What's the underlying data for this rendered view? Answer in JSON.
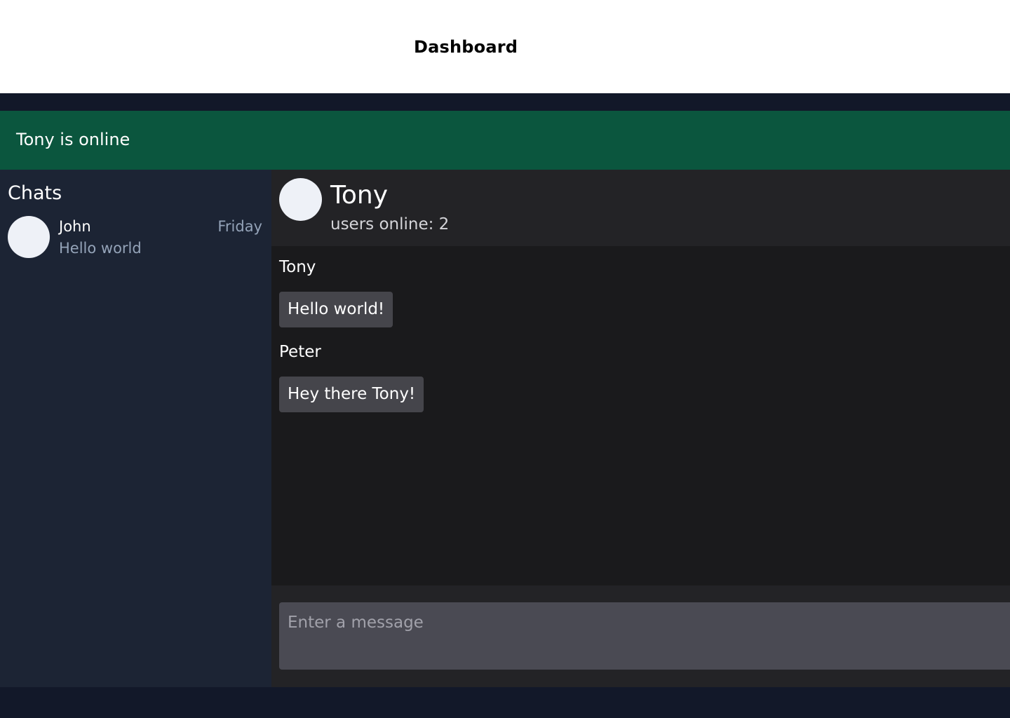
{
  "header": {
    "title": "Dashboard"
  },
  "status": {
    "online_text": "Tony is online"
  },
  "sidebar": {
    "title": "Chats",
    "chats": [
      {
        "name": "John",
        "preview": "Hello world",
        "time": "Friday"
      }
    ]
  },
  "conversation": {
    "name": "Tony",
    "subtitle": "users online: 2",
    "messages": [
      {
        "sender": "Tony",
        "text": "Hello world!"
      },
      {
        "sender": "Peter",
        "text": "Hey there Tony!"
      }
    ]
  },
  "composer": {
    "placeholder": "Enter a message"
  },
  "colors": {
    "online_banner": "#0b563e",
    "sidebar_bg": "#1c2434",
    "dark_strip": "#121829",
    "message_bubble": "#45454b",
    "avatar": "#eef1f7"
  }
}
